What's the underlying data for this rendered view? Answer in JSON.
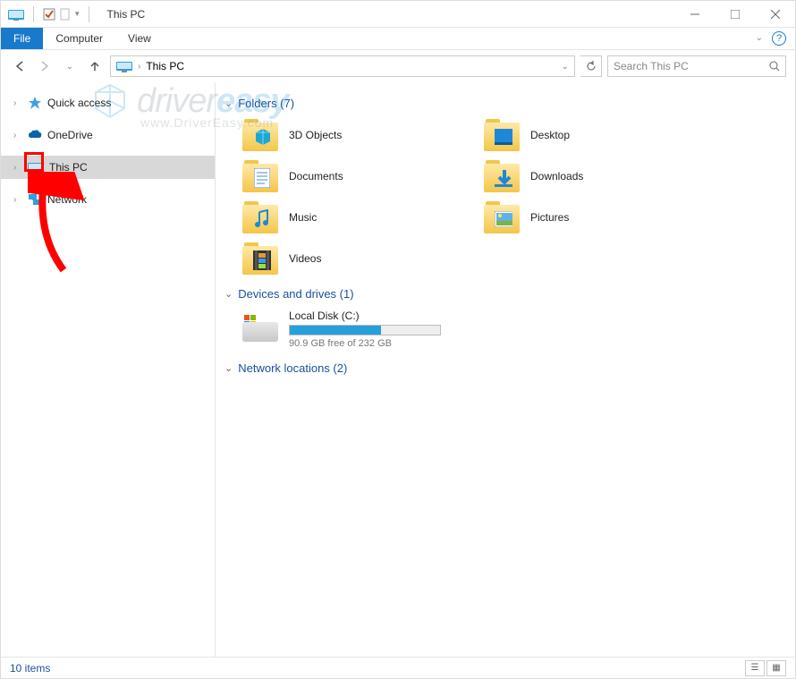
{
  "window": {
    "title": "This PC",
    "controls": {
      "minimize": "minimize",
      "maximize": "maximize",
      "close": "close"
    }
  },
  "ribbon": {
    "tabs": [
      "File",
      "Computer",
      "View"
    ]
  },
  "addressbar": {
    "path": "This PC",
    "search_placeholder": "Search This PC"
  },
  "navtree": {
    "items": [
      {
        "label": "Quick access",
        "icon": "star",
        "expandable": true
      },
      {
        "label": "OneDrive",
        "icon": "cloud",
        "expandable": true
      },
      {
        "label": "This PC",
        "icon": "pc",
        "expandable": true,
        "selected": true
      },
      {
        "label": "Network",
        "icon": "network",
        "expandable": true
      }
    ]
  },
  "sections": {
    "folders": {
      "title": "Folders (7)",
      "items": [
        {
          "label": "3D Objects",
          "badge": "cube"
        },
        {
          "label": "Desktop",
          "badge": "desktop"
        },
        {
          "label": "Documents",
          "badge": "doc"
        },
        {
          "label": "Downloads",
          "badge": "download"
        },
        {
          "label": "Music",
          "badge": "music"
        },
        {
          "label": "Pictures",
          "badge": "picture"
        },
        {
          "label": "Videos",
          "badge": "video"
        }
      ]
    },
    "drives": {
      "title": "Devices and drives (1)",
      "items": [
        {
          "label": "Local Disk (C:)",
          "free_text": "90.9 GB free of 232 GB",
          "fill_percent": 61
        }
      ]
    },
    "network": {
      "title": "Network locations (2)"
    }
  },
  "statusbar": {
    "text": "10 items"
  },
  "watermark": {
    "brand1": "driver",
    "brand2": "easy",
    "sub": "www.DriverEasy.com"
  }
}
